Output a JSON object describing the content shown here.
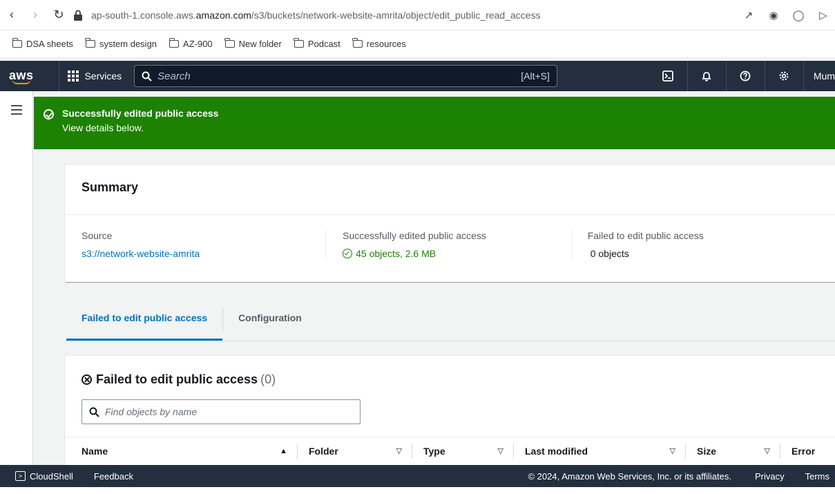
{
  "browser": {
    "url_prefix": "ap-south-1.console.aws.",
    "url_host": "amazon.com",
    "url_path": "/s3/buckets/network-website-amrita/object/edit_public_read_access",
    "bookmarks": [
      "DSA sheets",
      "system design",
      "AZ-900",
      "New folder",
      "Podcast",
      "resources"
    ]
  },
  "aws_nav": {
    "logo": "aws",
    "services_label": "Services",
    "search_placeholder": "Search",
    "search_shortcut": "[Alt+S]",
    "region_label": "Mum"
  },
  "flash": {
    "title": "Successfully edited public access",
    "message": "View details below."
  },
  "summary": {
    "title": "Summary",
    "source_label": "Source",
    "source_value": "s3://network-website-amrita",
    "success_label": "Successfully edited public access",
    "success_value": "45 objects, 2.6 MB",
    "failed_label": "Failed to edit public access",
    "failed_value": "0 objects"
  },
  "tabs": [
    {
      "label": "Failed to edit public access",
      "active": true
    },
    {
      "label": "Configuration",
      "active": false
    }
  ],
  "failed_panel": {
    "title": "Failed to edit public access",
    "count": "(0)",
    "search_placeholder": "Find objects by name",
    "columns": [
      "Name",
      "Folder",
      "Type",
      "Last modified",
      "Size",
      "Error"
    ]
  },
  "footer": {
    "cloudshell": "CloudShell",
    "feedback": "Feedback",
    "copyright": "© 2024, Amazon Web Services, Inc. or its affiliates.",
    "privacy": "Privacy",
    "terms": "Terms"
  },
  "colors": {
    "aws_nav_bg": "#232f3e",
    "success_green": "#1d8102",
    "link_blue": "#0073bb",
    "aws_orange": "#ff9900"
  }
}
